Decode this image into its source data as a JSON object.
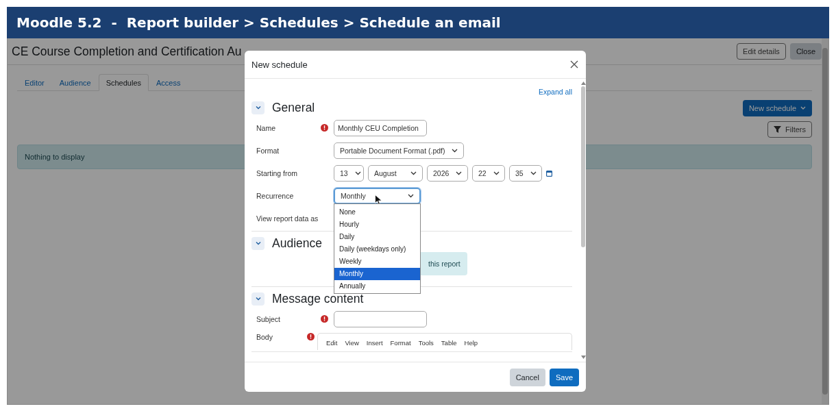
{
  "banner": {
    "title": "Moodle 5.2  -  Report builder > Schedules > Schedule an email"
  },
  "page": {
    "title": "CE Course Completion and Certification Au",
    "header_buttons": [
      {
        "label": "Edit details",
        "kind": "outline"
      },
      {
        "label": "Close",
        "kind": "secondary"
      }
    ],
    "tabs": [
      {
        "label": "Editor",
        "selected": false
      },
      {
        "label": "Audience",
        "selected": false
      },
      {
        "label": "Schedules",
        "selected": true
      },
      {
        "label": "Access",
        "selected": false
      }
    ],
    "new_schedule_button": "New schedule",
    "filters_button": "Filters",
    "empty_message": "Nothing to display"
  },
  "modal": {
    "title": "New schedule",
    "expand_all": "Expand all",
    "sections": [
      {
        "title": "General",
        "expanded": true,
        "fields": [
          {
            "kind": "text",
            "label": "Name",
            "required": true,
            "value": "Monthly CEU Completion"
          },
          {
            "kind": "select",
            "label": "Format",
            "required": false,
            "value": "Portable Document Format (.pdf)"
          },
          {
            "kind": "date",
            "label": "Starting from",
            "required": false,
            "parts": [
              "13",
              "August",
              "2026",
              "22",
              "35"
            ]
          },
          {
            "kind": "select",
            "label": "Recurrence",
            "required": false,
            "value": "Monthly",
            "focused": true,
            "options": [
              {
                "label": "None",
                "selected": false
              },
              {
                "label": "Hourly",
                "selected": false
              },
              {
                "label": "Daily",
                "selected": false
              },
              {
                "label": "Daily (weekdays only)",
                "selected": false
              },
              {
                "label": "Weekly",
                "selected": false
              },
              {
                "label": "Monthly",
                "selected": true
              },
              {
                "label": "Annually",
                "selected": false
              }
            ]
          },
          {
            "kind": "label",
            "label": "View report data as",
            "required": false
          }
        ]
      },
      {
        "title": "Audience",
        "expanded": true,
        "info": "this report"
      },
      {
        "title": "Message content",
        "expanded": true,
        "fields": [
          {
            "kind": "text",
            "label": "Subject",
            "required": true
          },
          {
            "kind": "editor",
            "label": "Body",
            "required": true,
            "menu": [
              "Edit",
              "View",
              "Insert",
              "Format",
              "Tools",
              "Table",
              "Help"
            ]
          }
        ]
      }
    ],
    "buttons": [
      {
        "label": "Cancel",
        "kind": "secondary"
      },
      {
        "label": "Save",
        "kind": "primary"
      }
    ]
  }
}
